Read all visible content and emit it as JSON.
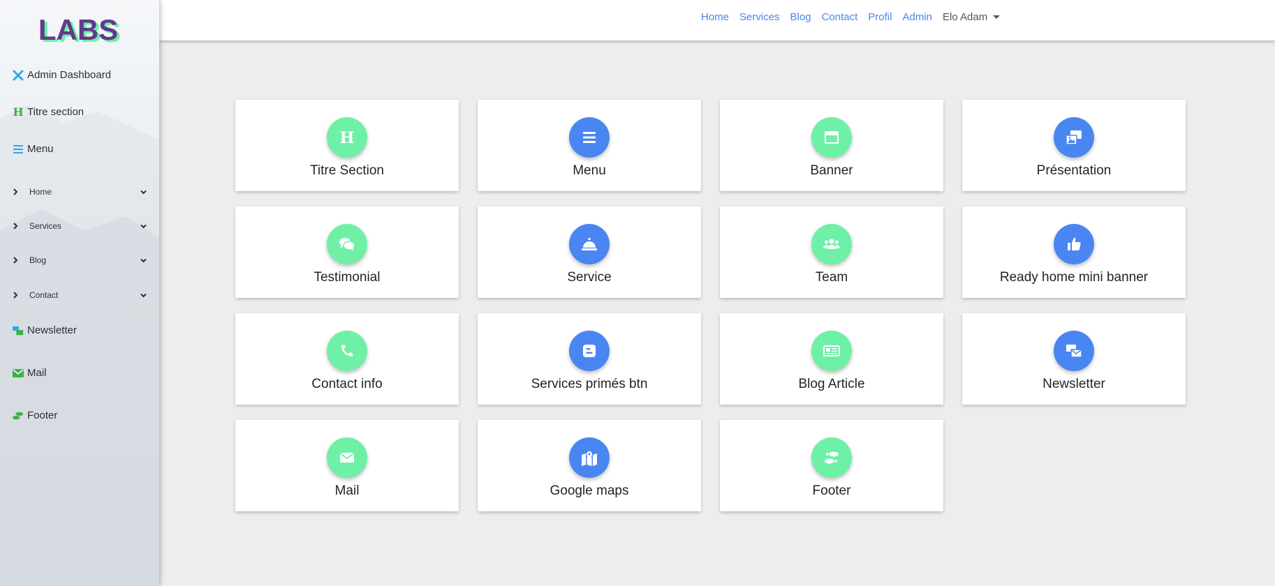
{
  "brand": {
    "logo_text": "LABS",
    "colors": {
      "purple": "#5b2a86",
      "green": "#6ef0a6"
    }
  },
  "sidebar": {
    "links": [
      {
        "label": "Admin Dashboard",
        "icon": "tools-icon"
      },
      {
        "label": "Titre section",
        "icon": "heading-icon"
      },
      {
        "label": "Menu",
        "icon": "bars-icon"
      }
    ],
    "collapsibles": [
      {
        "label": "Home"
      },
      {
        "label": "Services"
      },
      {
        "label": "Blog"
      },
      {
        "label": "Contact"
      }
    ],
    "bottom_links": [
      {
        "label": "Newsletter",
        "icon": "mail-bulk-icon"
      },
      {
        "label": "Mail",
        "icon": "envelope-icon"
      },
      {
        "label": "Footer",
        "icon": "shoe-prints-icon"
      }
    ]
  },
  "topnav": {
    "links": [
      "Home",
      "Services",
      "Blog",
      "Contact",
      "Profil",
      "Admin"
    ],
    "user": "Elo Adam"
  },
  "cards": [
    {
      "label": "Titre Section",
      "icon": "heading-icon",
      "color": "green"
    },
    {
      "label": "Menu",
      "icon": "bars-icon",
      "color": "blue"
    },
    {
      "label": "Banner",
      "icon": "window-icon",
      "color": "green"
    },
    {
      "label": "Présentation",
      "icon": "photo-video-icon",
      "color": "blue"
    },
    {
      "label": "Testimonial",
      "icon": "comments-icon",
      "color": "green"
    },
    {
      "label": "Service",
      "icon": "concierge-bell-icon",
      "color": "blue"
    },
    {
      "label": "Team",
      "icon": "users-icon",
      "color": "green"
    },
    {
      "label": "Ready home mini banner",
      "icon": "thumbs-up-icon",
      "color": "blue"
    },
    {
      "label": "Contact info",
      "icon": "phone-icon",
      "color": "green"
    },
    {
      "label": "Services primés btn",
      "icon": "blogger-icon",
      "color": "blue"
    },
    {
      "label": "Blog Article",
      "icon": "newspaper-icon",
      "color": "green"
    },
    {
      "label": "Newsletter",
      "icon": "mail-bulk-icon",
      "color": "blue"
    },
    {
      "label": "Mail",
      "icon": "envelope-icon",
      "color": "green"
    },
    {
      "label": "Google maps",
      "icon": "map-marked-icon",
      "color": "blue"
    },
    {
      "label": "Footer",
      "icon": "shoe-prints-icon",
      "color": "green"
    }
  ]
}
